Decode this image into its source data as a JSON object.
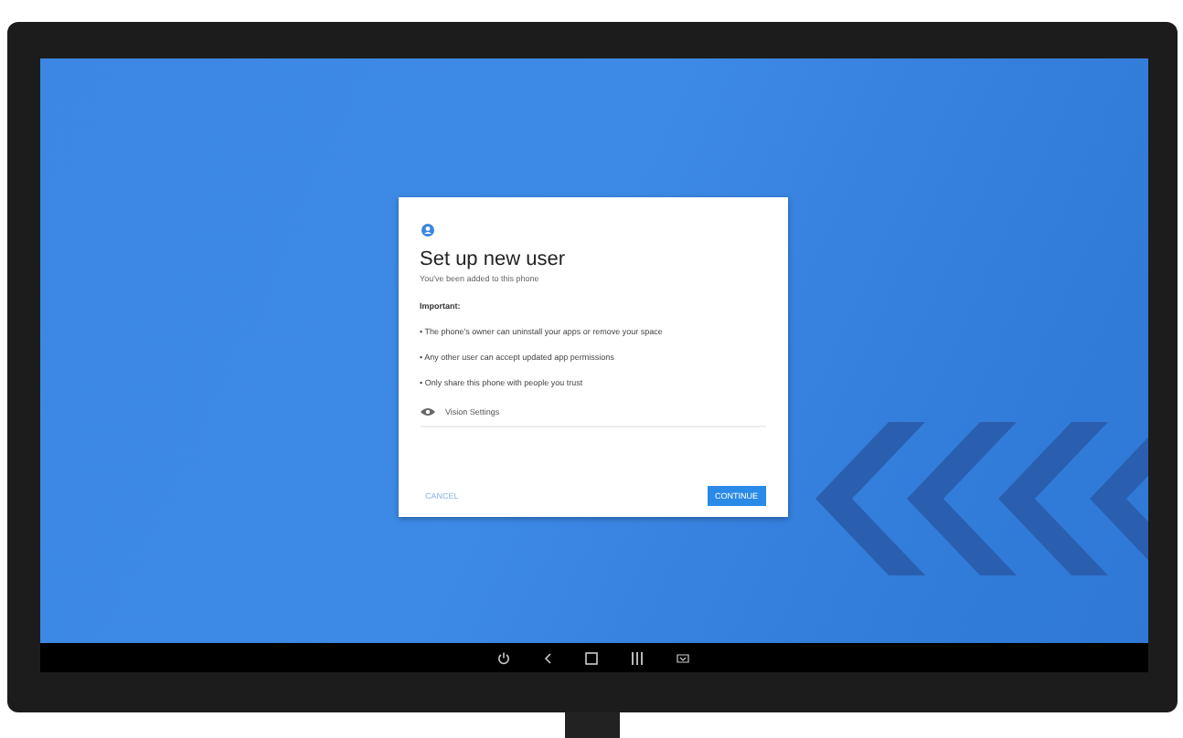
{
  "dialog": {
    "title": "Set up new user",
    "subtitle": "You've been added to this phone",
    "heading": "Important:",
    "points": [
      "• The phone's owner can uninstall your apps or remove your space",
      "• Any other user can accept updated app permissions",
      "• Only share this phone with people you trust"
    ],
    "setting": "Vision Settings",
    "buttons": [
      {
        "label": "CANCEL",
        "kind": "text"
      },
      {
        "label": "CONTINUE",
        "kind": "primary"
      }
    ]
  }
}
